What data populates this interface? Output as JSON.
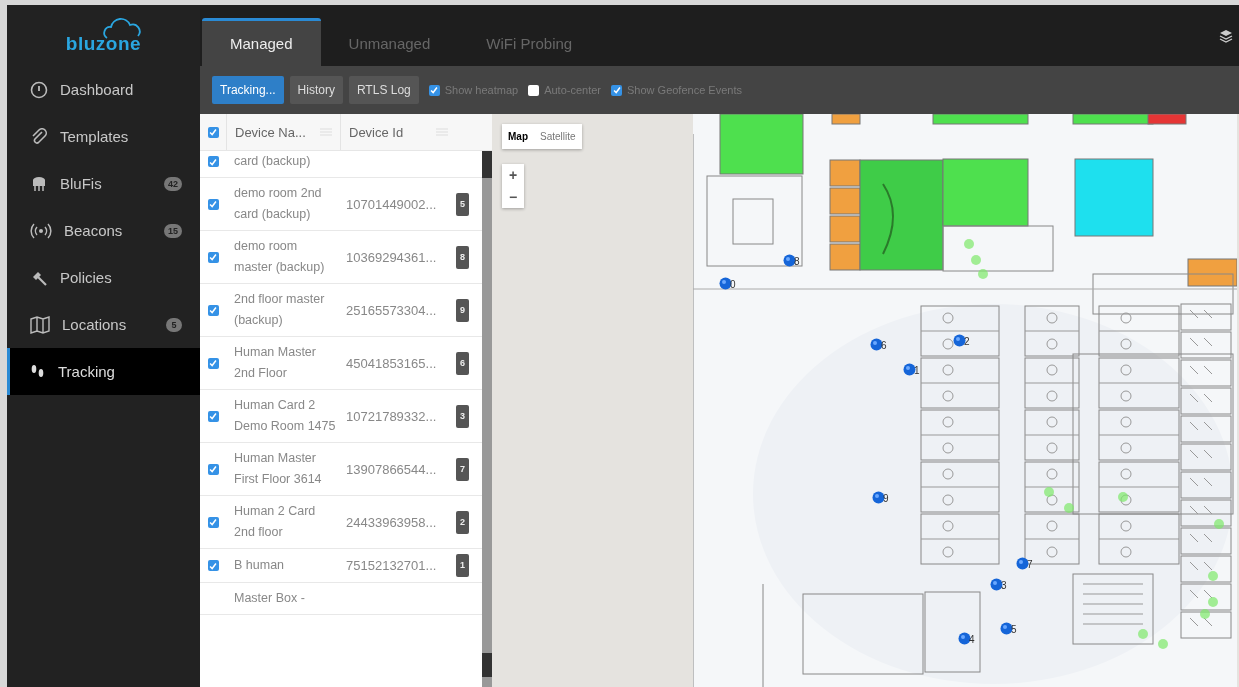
{
  "sidebar": {
    "logo": "bluzone",
    "items": [
      {
        "label": "Dashboard",
        "selected": false
      },
      {
        "label": "Templates",
        "selected": false
      },
      {
        "label": "BluFis",
        "badge": "42",
        "selected": false
      },
      {
        "label": "Beacons",
        "badge": "15",
        "selected": false
      },
      {
        "label": "Policies",
        "selected": false
      },
      {
        "label": "Locations",
        "badge": "5",
        "selected": false
      },
      {
        "label": "Tracking",
        "selected": true
      }
    ]
  },
  "tabs": [
    {
      "label": "Managed",
      "selected": true
    },
    {
      "label": "Unmanaged",
      "selected": false
    },
    {
      "label": "WiFi Probing",
      "selected": false
    }
  ],
  "toolbar": {
    "buttons": [
      {
        "label": "Tracking...",
        "selected": true
      },
      {
        "label": "History",
        "selected": false
      },
      {
        "label": "RTLS Log",
        "selected": false
      }
    ],
    "options": [
      {
        "label": "Show heatmap",
        "checked": true
      },
      {
        "label": "Auto-center",
        "checked": false
      },
      {
        "label": "Show Geofence Events",
        "checked": true
      }
    ]
  },
  "table": {
    "all_checked": true,
    "columns": [
      "Device Na...",
      "Device Id"
    ],
    "rows": [
      {
        "name": "card (backup)",
        "checked": true
      },
      {
        "name": "demo room 2nd card (backup)",
        "id": "10701449002...",
        "badge": "5",
        "checked": true
      },
      {
        "name": "demo room master (backup)",
        "id": "10369294361...",
        "badge": "8",
        "checked": true
      },
      {
        "name": "2nd floor master (backup)",
        "id": "25165573304...",
        "badge": "9",
        "checked": true
      },
      {
        "name": "Human Master 2nd Floor",
        "id": "45041853165...",
        "badge": "6",
        "checked": true
      },
      {
        "name": "Human Card 2 Demo Room 1475",
        "id": "10721789332...",
        "badge": "3",
        "checked": true
      },
      {
        "name": "Human Master First Floor 3614",
        "id": "13907866544...",
        "badge": "7",
        "checked": true
      },
      {
        "name": "Human 2 Card 2nd floor",
        "id": "24433963958...",
        "badge": "2",
        "checked": true
      },
      {
        "name": "B human",
        "id": "75152132701...",
        "badge": "1",
        "checked": true
      },
      {
        "name": "Master Box -"
      }
    ]
  },
  "map": {
    "types": [
      {
        "label": "Map",
        "selected": true
      },
      {
        "label": "Satellite",
        "selected": false
      }
    ],
    "zoom_in": "+",
    "zoom_out": "−",
    "markers": [
      "0",
      "8",
      "6",
      "2",
      "1",
      "9",
      "7",
      "3",
      "5",
      "4"
    ]
  }
}
